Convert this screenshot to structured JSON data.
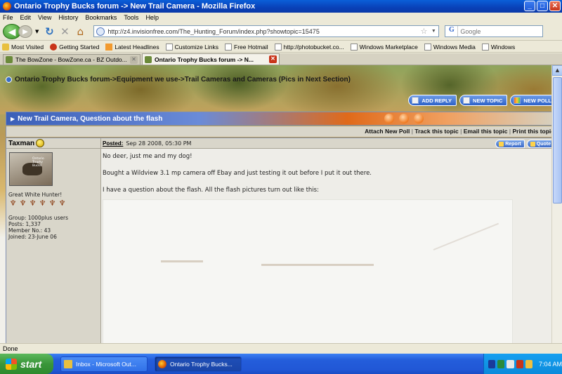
{
  "window": {
    "title": "Ontario Trophy Bucks forum -> New Trail Camera - Mozilla Firefox",
    "min": "_",
    "max": "□",
    "close": "✕"
  },
  "menu": [
    "File",
    "Edit",
    "View",
    "History",
    "Bookmarks",
    "Tools",
    "Help"
  ],
  "nav": {
    "url": "http://z4.invisionfree.com/The_Hunting_Forum/index.php?showtopic=15475",
    "search_placeholder": "Google",
    "search_engine_label": "G"
  },
  "bookmarks": [
    {
      "label": "Most Visited",
      "icon": "star-icon"
    },
    {
      "label": "Getting Started",
      "icon": "firefox-icon"
    },
    {
      "label": "Latest Headlines",
      "icon": "rss-icon"
    },
    {
      "label": "Customize Links",
      "icon": "page-icon"
    },
    {
      "label": "Free Hotmail",
      "icon": "page-icon"
    },
    {
      "label": "http://photobucket.co...",
      "icon": "page-icon"
    },
    {
      "label": "Windows Marketplace",
      "icon": "page-icon"
    },
    {
      "label": "Windows Media",
      "icon": "page-icon"
    },
    {
      "label": "Windows",
      "icon": "page-icon"
    }
  ],
  "tabs": [
    {
      "label": "The BowZone - BowZone.ca - BZ Outdo...",
      "active": false
    },
    {
      "label": "Ontario Trophy Bucks forum -> N...",
      "active": true
    }
  ],
  "page": {
    "breadcrumb": "Ontario Trophy Bucks forum->Equipment we use->Trail Cameras and Cameras (Pics in Next Section)",
    "actions": [
      "ADD REPLY",
      "NEW TOPIC",
      "NEW POLL"
    ],
    "topic_title": "New Trail Camera, Question about the flash",
    "options": [
      "Attach New Poll",
      "Track this topic",
      "Email this topic",
      "Print this topic"
    ],
    "options_sep": "|",
    "post": {
      "author": "Taxman",
      "avatar_text": "Ontario Trophy Bucks",
      "member_title": "Great White Hunter!",
      "stats": [
        "Group: 1000plus users",
        "Posts: 1,337",
        "Member No.: 43",
        "Joined: 23-June 06"
      ],
      "posted_label": "Posted:",
      "posted_date": "Sep 28 2008, 05:30 PM",
      "report_label": "Report",
      "quote_label": "Quote",
      "paragraphs": [
        "No deer, just me and my dog!",
        "Bought a Wildview 3.1 mp camera off Ebay and just testing it out before I put it out there.",
        "I have a question about the flash. All the flash pictures turn out like this:"
      ]
    }
  },
  "status": "Done",
  "taskbar": {
    "start": "start",
    "tasks": [
      {
        "label": "Inbox - Microsoft Out...",
        "icon": "mail-icon"
      },
      {
        "label": "Ontario Trophy Bucks...",
        "icon": "firefox-icon"
      }
    ],
    "clock": "7:04 AM"
  }
}
